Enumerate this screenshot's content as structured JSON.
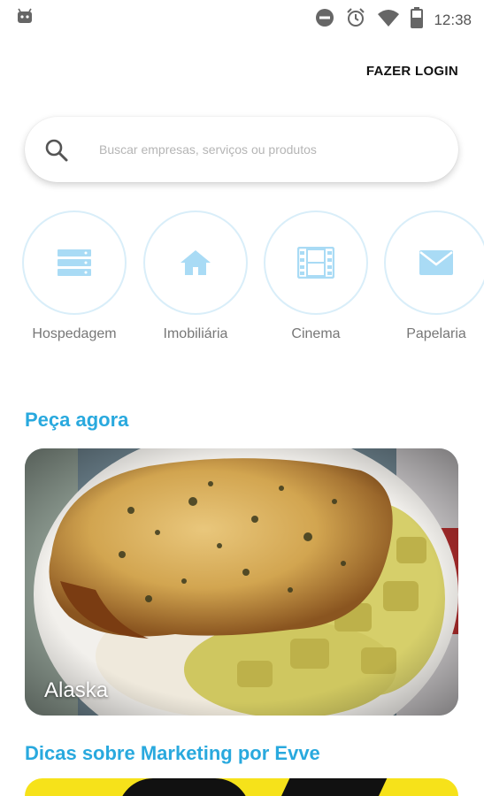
{
  "status_bar": {
    "time": "12:38",
    "icons": [
      "android-icon",
      "do-not-disturb-icon",
      "alarm-icon",
      "wifi-icon",
      "battery-icon"
    ]
  },
  "header": {
    "login_label": "FAZER LOGIN"
  },
  "search": {
    "placeholder": "Buscar empresas, serviços ou produtos",
    "icon": "search-icon"
  },
  "categories": [
    {
      "label": "Hospedagem",
      "icon": "server-icon"
    },
    {
      "label": "Imobiliária",
      "icon": "house-icon"
    },
    {
      "label": "Cinema",
      "icon": "film-icon"
    },
    {
      "label": "Papelaria",
      "icon": "envelope-icon"
    }
  ],
  "sections": {
    "order_now": {
      "title": "Peça agora",
      "items": [
        {
          "name": "Alaska"
        }
      ]
    },
    "marketing_tips": {
      "title": "Dicas sobre Marketing por Evve"
    }
  },
  "colors": {
    "accent": "#29a9de",
    "category_border": "#d9eef9",
    "category_icon": "#a9dbf5",
    "marketing_card": "#f6e21a"
  }
}
